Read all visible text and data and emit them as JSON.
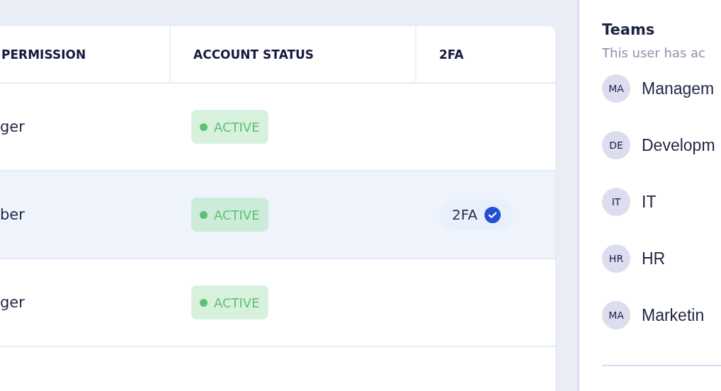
{
  "table": {
    "columns": [
      "PERMISSION",
      "ACCOUNT STATUS",
      "2FA"
    ],
    "rows": [
      {
        "permission": "ger",
        "status": "ACTIVE",
        "selected": false,
        "two_factor": null
      },
      {
        "permission": "ber",
        "status": "ACTIVE",
        "selected": true,
        "two_factor": "2FA"
      },
      {
        "permission": "ger",
        "status": "ACTIVE",
        "selected": false,
        "two_factor": null
      }
    ]
  },
  "teams": {
    "title": "Teams",
    "subtitle": "This user has ac",
    "items": [
      {
        "initials": "MA",
        "name": "Managem"
      },
      {
        "initials": "DE",
        "name": "Developm"
      },
      {
        "initials": "IT",
        "name": "IT"
      },
      {
        "initials": "HR",
        "name": "HR"
      },
      {
        "initials": "MA",
        "name": "Marketin"
      }
    ]
  }
}
